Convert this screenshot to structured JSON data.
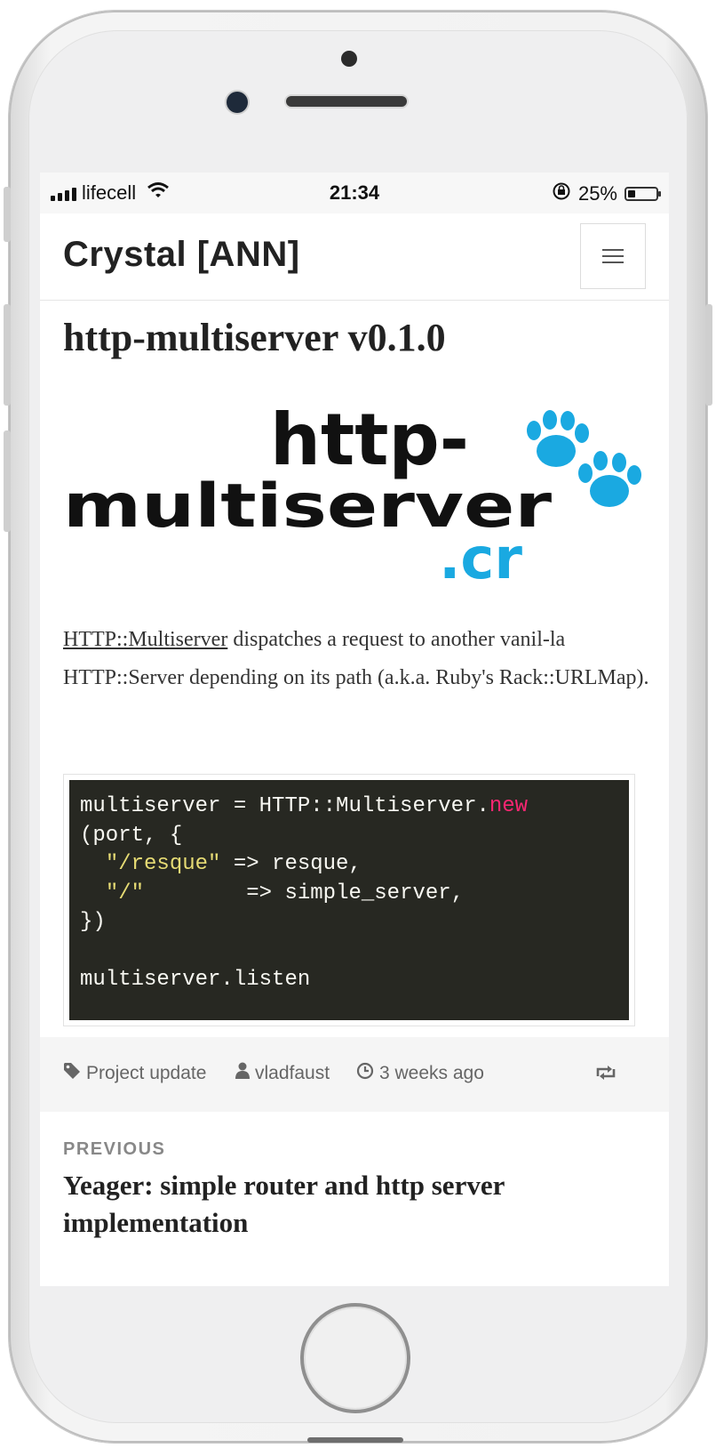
{
  "status_bar": {
    "carrier": "lifecell",
    "time": "21:34",
    "battery_percent": "25%",
    "battery_level": 0.25
  },
  "navbar": {
    "brand": "Crystal [ANN]",
    "menu_icon": "hamburger-menu-icon"
  },
  "post": {
    "title": "http-multiserver v0.1.0",
    "logo": {
      "line1": "http-",
      "line2": "multiserver",
      "suffix": ".cr",
      "paw_color": "#1aa9e1"
    },
    "description": {
      "link_text": "HTTP::Multiserver",
      "text": " dispatches a request to another vanil-la HTTP::Server depending on its path (a.k.a. Ruby's Rack::URLMap)."
    },
    "code": {
      "line1_plain": "multiserver = HTTP::Multiserver.",
      "line1_keyword": "new",
      "line2": "(port, {",
      "line3_string": "\"/resque\"",
      "line3_rest": " => resque,",
      "line4_string": "\"/\"",
      "line4_rest": "        => simple_server,",
      "line5": "})",
      "line7": "multiserver.listen"
    }
  },
  "meta": {
    "category": "Project update",
    "author": "vladfaust",
    "time_ago": "3 weeks ago"
  },
  "previous": {
    "label": "PREVIOUS",
    "title": "Yeager: simple router and http server implementation"
  },
  "colors": {
    "code_bg": "#272822",
    "code_keyword": "#f92672",
    "code_string": "#e6db74",
    "logo_blue": "#1aa9e1"
  }
}
